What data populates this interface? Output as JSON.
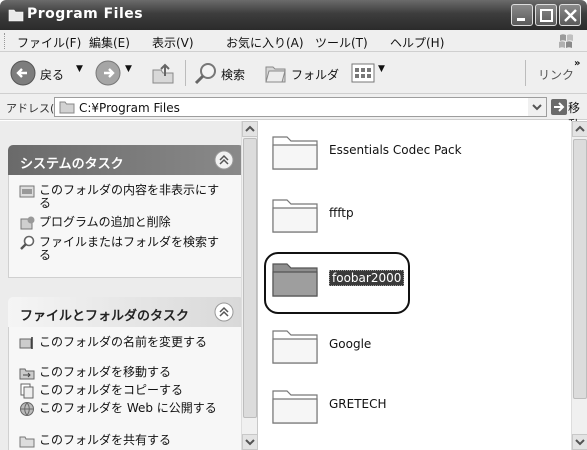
{
  "window": {
    "title": "Program Files"
  },
  "menu": {
    "items": [
      "ファイル(F)",
      "編集(E)",
      "表示(V)",
      "お気に入り(A)",
      "ツール(T)",
      "ヘルプ(H)"
    ]
  },
  "toolbar": {
    "back_label": "戻る",
    "search_label": "検索",
    "folders_label": "フォルダ",
    "links_label": "リンク"
  },
  "address": {
    "label": "アドレス(D)",
    "path": "C:¥Program Files",
    "go_label": "移動"
  },
  "system_tasks": {
    "title": "システムのタスク",
    "items": [
      "このフォルダの内容を非表示にする",
      "プログラムの追加と削除",
      "ファイルまたはフォルダを検索する"
    ]
  },
  "file_tasks": {
    "title": "ファイルとフォルダのタスク",
    "items": [
      "このフォルダの名前を変更する",
      "このフォルダを移動する",
      "このフォルダをコピーする",
      "このフォルダを Web に公開する",
      "このフォルダを共有する"
    ]
  },
  "folders": [
    {
      "name": "Essentials Codec Pack",
      "selected": false
    },
    {
      "name": "ffftp",
      "selected": false
    },
    {
      "name": "foobar2000",
      "selected": true
    },
    {
      "name": "Google",
      "selected": false
    },
    {
      "name": "GRETECH",
      "selected": false
    }
  ]
}
